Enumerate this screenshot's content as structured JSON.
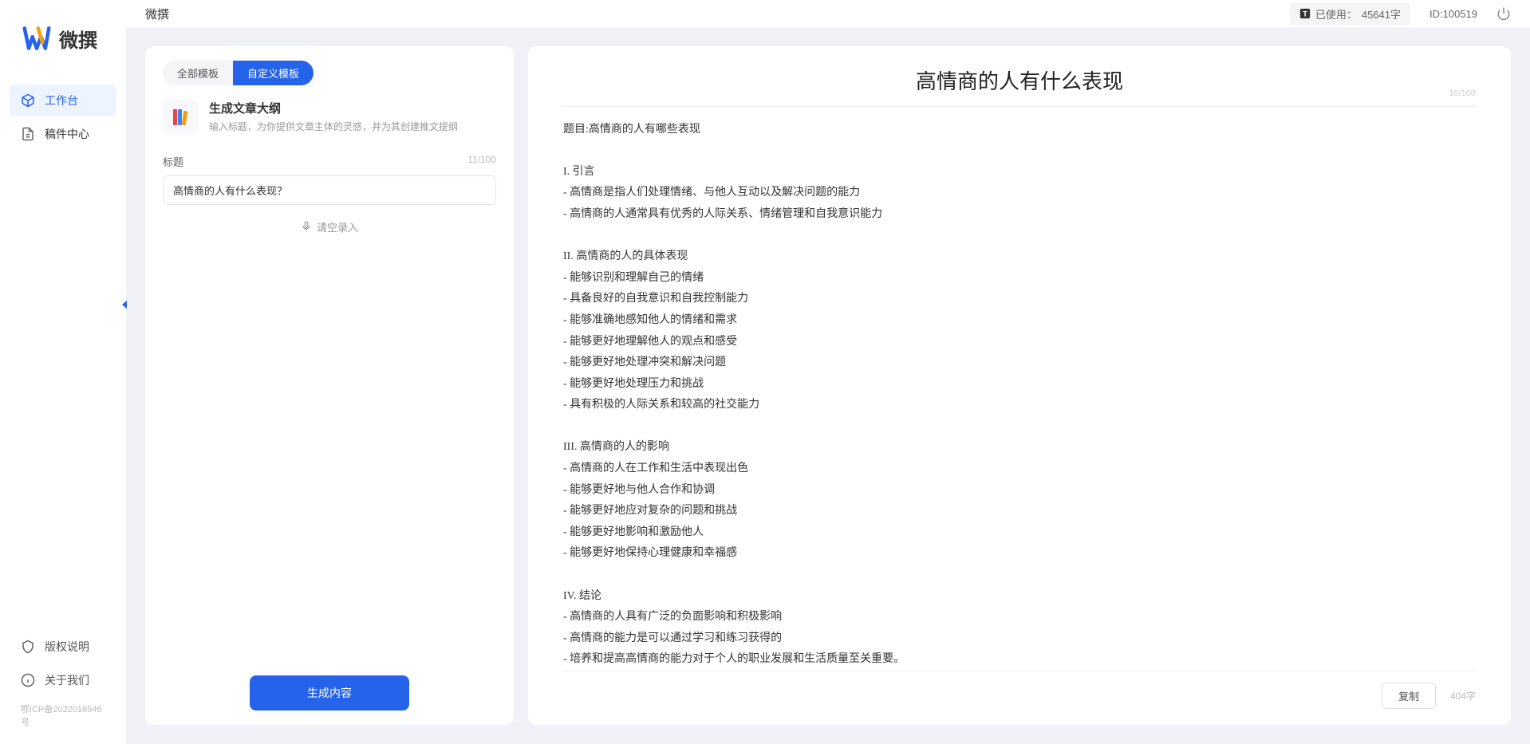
{
  "app_name": "微撰",
  "topbar": {
    "title": "微撰",
    "usage_label": "已使用：",
    "usage_value": "45641字",
    "id_label": "ID:100519"
  },
  "sidebar": {
    "nav": [
      {
        "label": "工作台",
        "active": true
      },
      {
        "label": "稿件中心",
        "active": false
      }
    ],
    "footer": [
      {
        "label": "版权说明"
      },
      {
        "label": "关于我们"
      }
    ],
    "icp": "鄂ICP备2022016946号"
  },
  "left": {
    "tabs": {
      "all": "全部模板",
      "custom": "自定义模板"
    },
    "tool": {
      "title": "生成文章大纲",
      "desc": "输入标题，为你提供文章主体的灵感，并为其创建推文提纲"
    },
    "field_label": "标题",
    "field_count": "11/100",
    "title_value": "高情商的人有什么表现？",
    "voice_label": "请空录入",
    "gen_label": "生成内容"
  },
  "right": {
    "title": "高情商的人有什么表现",
    "title_count": "10/100",
    "body": "题目:高情商的人有哪些表现\n\nI. 引言\n- 高情商是指人们处理情绪、与他人互动以及解决问题的能力\n- 高情商的人通常具有优秀的人际关系、情绪管理和自我意识能力\n\nII. 高情商的人的具体表现\n- 能够识别和理解自己的情绪\n- 具备良好的自我意识和自我控制能力\n- 能够准确地感知他人的情绪和需求\n- 能够更好地理解他人的观点和感受\n- 能够更好地处理冲突和解决问题\n- 能够更好地处理压力和挑战\n- 具有积极的人际关系和较高的社交能力\n\nIII. 高情商的人的影响\n- 高情商的人在工作和生活中表现出色\n- 能够更好地与他人合作和协调\n- 能够更好地应对复杂的问题和挑战\n- 能够更好地影响和激励他人\n- 能够更好地保持心理健康和幸福感\n\nIV. 结论\n- 高情商的人具有广泛的负面影响和积极影响\n- 高情商的能力是可以通过学习和练习获得的\n- 培养和提高高情商的能力对于个人的职业发展和生活质量至关重要。",
    "copy_label": "复制",
    "char_count": "404字"
  }
}
